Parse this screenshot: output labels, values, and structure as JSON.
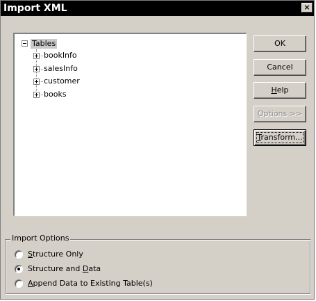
{
  "window": {
    "title": "Import XML",
    "close_glyph": "×"
  },
  "tree": {
    "root": {
      "label": "Tables",
      "expander": "minus",
      "selected": true
    },
    "items": [
      {
        "label": "bookInfo",
        "expander": "plus"
      },
      {
        "label": "salesInfo",
        "expander": "plus"
      },
      {
        "label": "customer",
        "expander": "plus"
      },
      {
        "label": "books",
        "expander": "plus"
      }
    ]
  },
  "buttons": {
    "ok": {
      "label": "OK",
      "enabled": true
    },
    "cancel": {
      "label": "Cancel",
      "enabled": true
    },
    "help": {
      "label_pre": "",
      "label_mnemonic": "H",
      "label_post": "elp",
      "enabled": true
    },
    "options": {
      "label_pre": "",
      "label_mnemonic": "O",
      "label_post": "ptions >>",
      "enabled": false
    },
    "transform": {
      "label_pre": "",
      "label_mnemonic": "T",
      "label_post": "ransform...",
      "enabled": true,
      "focused": true
    }
  },
  "import_options": {
    "legend": "Import Options",
    "options": [
      {
        "pre": "",
        "mnemonic": "S",
        "post": "tructure Only",
        "selected": false
      },
      {
        "pre": "Structure and ",
        "mnemonic": "D",
        "post": "ata",
        "selected": true
      },
      {
        "pre": "",
        "mnemonic": "A",
        "post": "ppend Data to Existing Table(s)",
        "selected": false
      }
    ]
  },
  "colors": {
    "face": "#d4d0c8",
    "titlebar": "#000000",
    "selection": "#c8c8c8",
    "disabled_text": "#8c8c8c"
  }
}
